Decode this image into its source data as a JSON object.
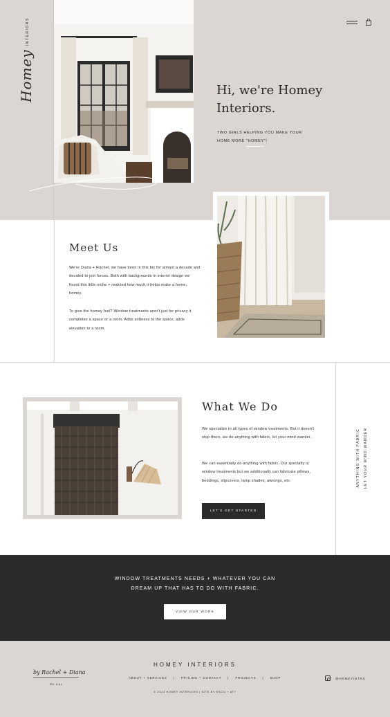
{
  "brand": {
    "script": "Homey",
    "tag": "INTERIORS"
  },
  "header": {
    "menu_icon": "hamburger-icon",
    "cart_icon": "shopping-bag-icon"
  },
  "hero": {
    "title_line1": "Hi, we're Homey",
    "title_line2": "Interiors.",
    "subtitle_line1": "TWO GIRLS HELPING YOU MAKE YOUR",
    "subtitle_line2": "HOME MORE \"HOMEY\"!"
  },
  "meet": {
    "title": "Meet Us",
    "p1": "We're Diana + Rachel, we have been in this biz for almost a decade and decided to join forces. Both with backgrounds in interior design we found this little niche + realized how much it helps make a home, homey.",
    "p2": "To give the homey feel? Window treatments aren't just for privacy it completes a space or a room. Adds softness to the space, adds elevation to a room."
  },
  "what": {
    "title": "What We Do",
    "p1": "We specialize in all types of window treatments. But it doesn't stop there, we do anything with fabric, let your mind wander.",
    "p2": "We can essentially do anything with fabric. Our specialty is window treatments but we additionally can fabricate pillows, beddings, slipcovers, lamp shades, awnings, etc.",
    "cta": "LET'S GET STARTED",
    "vertical_line1": "ANYTHING WITH FABRIC",
    "vertical_line2": "LET YOUR MIND WANDER"
  },
  "band": {
    "line1": "WINDOW TREATMENTS NEEDS + WHATEVER YOU CAN",
    "line2": "DREAM UP THAT HAS TO DO WITH FABRIC.",
    "button": "VIEW OUR WORK"
  },
  "footer": {
    "brand": "HOMEY INTERIORS",
    "nav": [
      "ABOUT + SERVICES",
      "PRICING + CONTACT",
      "PROJECTS",
      "SHOP"
    ],
    "separator": "|",
    "copyright": "© 2023 HOMEY INTERIORS | SITE BY ESCO + ATT",
    "signature": "by Rachel + Diana",
    "signature_small": "RE  KAL",
    "instagram_icon": "instagram-icon",
    "instagram_handle": "@HOMEYINTRS"
  }
}
